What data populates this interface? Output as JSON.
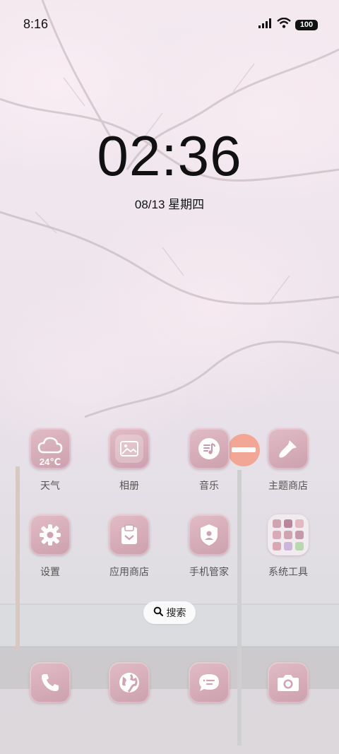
{
  "status_bar": {
    "time": "8:16",
    "battery": "100"
  },
  "lockscreen_clock": {
    "time": "02:36",
    "date": "08/13 星期四"
  },
  "apps": [
    {
      "label": "天气",
      "icon": "weather-cloud-icon",
      "temp": "24℃"
    },
    {
      "label": "相册",
      "icon": "gallery-icon"
    },
    {
      "label": "音乐",
      "icon": "music-icon"
    },
    {
      "label": "主题商店",
      "icon": "theme-brush-icon"
    },
    {
      "label": "设置",
      "icon": "gear-icon"
    },
    {
      "label": "应用商店",
      "icon": "app-store-icon"
    },
    {
      "label": "手机管家",
      "icon": "security-shield-icon"
    },
    {
      "label": "系统工具",
      "icon": "folder-icon"
    }
  ],
  "search": {
    "label": "搜索"
  },
  "dock": [
    {
      "icon": "phone-icon"
    },
    {
      "icon": "browser-globe-icon"
    },
    {
      "icon": "messages-icon"
    },
    {
      "icon": "camera-icon"
    }
  ],
  "colors": {
    "icon_bg": "#d6aeb9",
    "icon_glyph": "#ffffff",
    "label_text": "#555555"
  }
}
